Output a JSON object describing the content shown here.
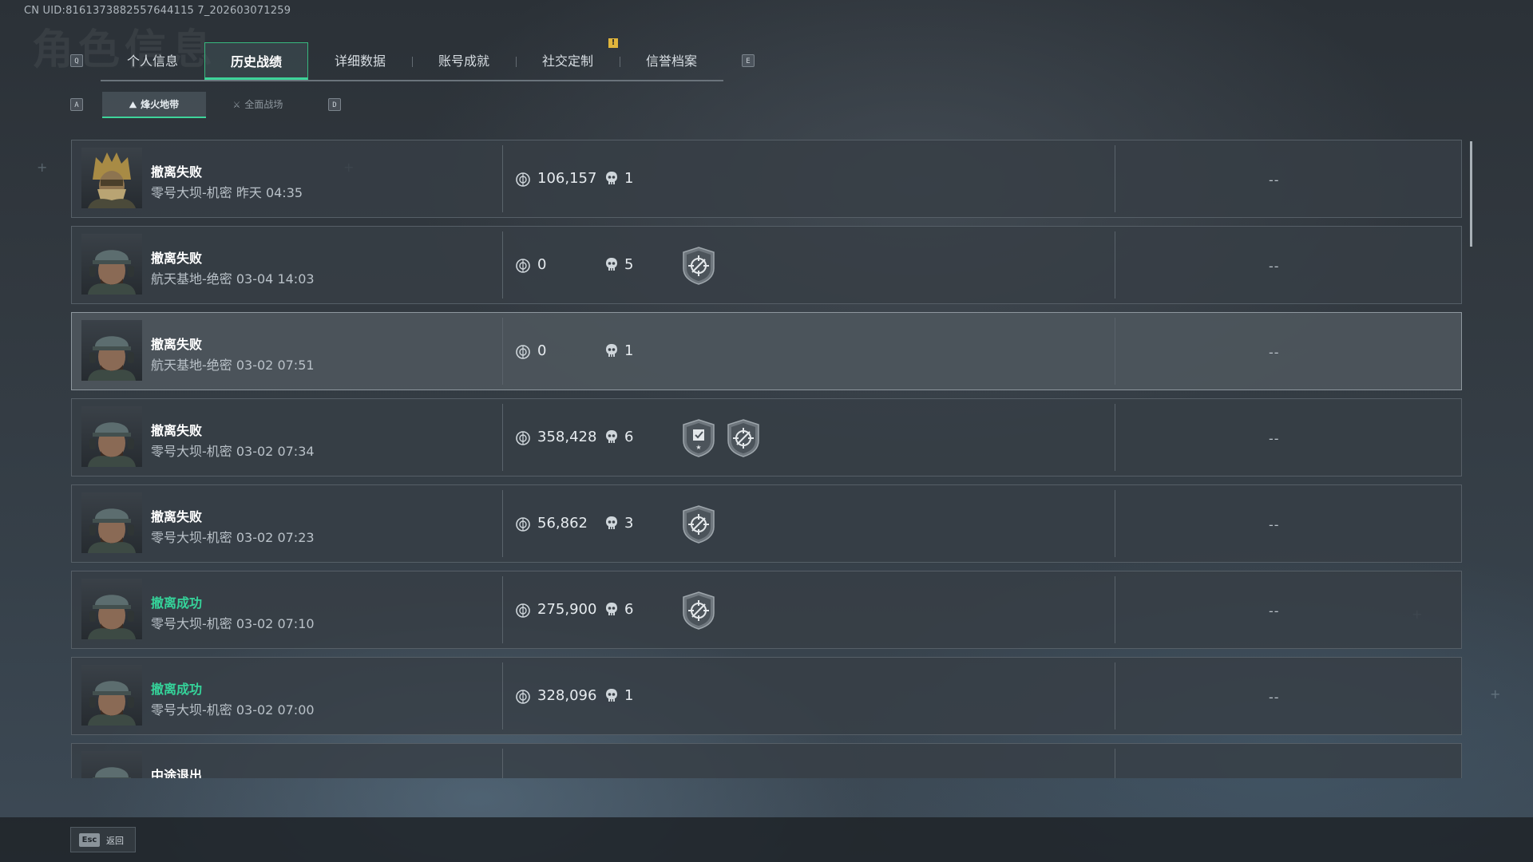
{
  "uid": "CN UID:8161373882557644115 7_202603071259",
  "ghost_title": "角色信息",
  "keys": {
    "tab_prev": "Q",
    "tab_next": "E",
    "sub_prev": "A",
    "sub_next": "D"
  },
  "tabs": [
    {
      "label": "个人信息"
    },
    {
      "label": "历史战绩"
    },
    {
      "label": "详细数据"
    },
    {
      "label": "账号成就"
    },
    {
      "label": "社交定制"
    },
    {
      "label": "信誉档案"
    }
  ],
  "notice_badge": "!",
  "subtabs": [
    {
      "label": "烽火地带",
      "icon": "mountain-icon"
    },
    {
      "label": "全面战场",
      "icon": "crossed-swords-icon"
    }
  ],
  "colors": {
    "accent": "#3ed49a",
    "success": "#35d39a",
    "notice": "#e0b53c"
  },
  "matches": [
    {
      "status": "撤离失败",
      "success": false,
      "map": "零号大坝-机密 昨天 04:35",
      "value": "106,157",
      "kills": "1",
      "badges": [],
      "extra": "--",
      "avatar": "gold-helmet-operator"
    },
    {
      "status": "撤离失败",
      "success": false,
      "map": "航天基地-绝密 03-04 14:03",
      "value": "0",
      "kills": "5",
      "badges": [
        "crosshair-badge-icon"
      ],
      "extra": "--",
      "avatar": "cap-operator"
    },
    {
      "status": "撤离失败",
      "success": false,
      "map": "航天基地-绝密 03-02 07:51",
      "value": "0",
      "kills": "1",
      "badges": [],
      "extra": "--",
      "avatar": "cap-operator"
    },
    {
      "status": "撤离失败",
      "success": false,
      "map": "零号大坝-机密 03-02 07:34",
      "value": "358,428",
      "kills": "6",
      "badges": [
        "shield-check-badge-icon",
        "crosshair-badge-icon"
      ],
      "extra": "--",
      "avatar": "cap-operator"
    },
    {
      "status": "撤离失败",
      "success": false,
      "map": "零号大坝-机密 03-02 07:23",
      "value": "56,862",
      "kills": "3",
      "badges": [
        "crosshair-badge-icon"
      ],
      "extra": "--",
      "avatar": "cap-operator"
    },
    {
      "status": "撤离成功",
      "success": true,
      "map": "零号大坝-机密 03-02 07:10",
      "value": "275,900",
      "kills": "6",
      "badges": [
        "crosshair-badge-icon"
      ],
      "extra": "--",
      "avatar": "cap-operator"
    },
    {
      "status": "撤离成功",
      "success": true,
      "map": "零号大坝-机密 03-02 07:00",
      "value": "328,096",
      "kills": "1",
      "badges": [],
      "extra": "--",
      "avatar": "cap-operator"
    },
    {
      "status": "中途退出",
      "success": false,
      "map": "",
      "value": "",
      "kills": "",
      "badges": [],
      "extra": "",
      "avatar": "cap-operator"
    }
  ],
  "footer": {
    "esc_key": "Esc",
    "back_label": "返回"
  }
}
